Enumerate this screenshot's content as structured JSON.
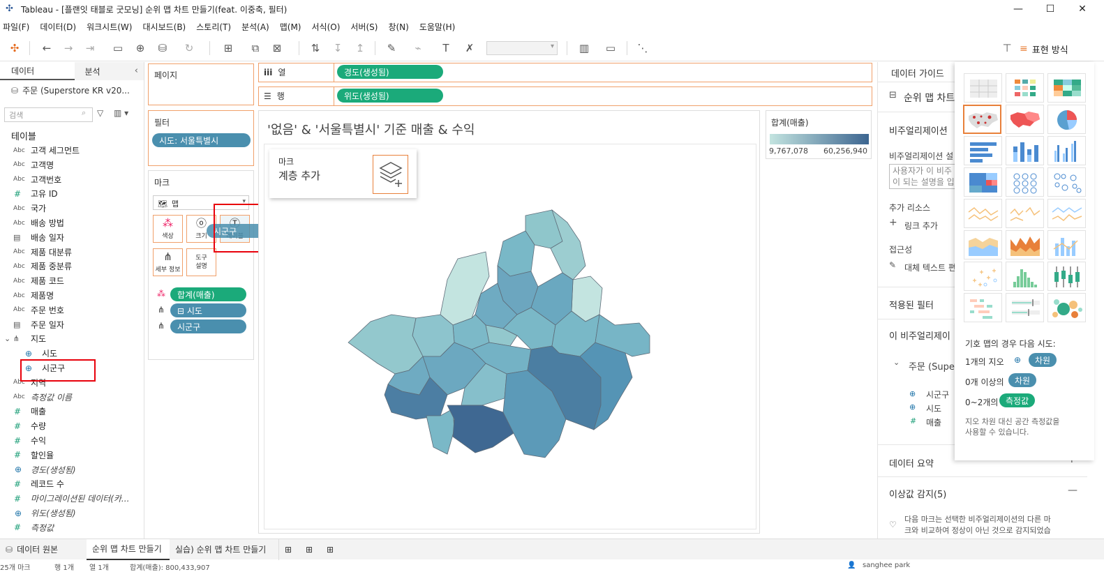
{
  "window": {
    "title": "Tableau - [플랜잇 태블로 굿모닝] 순위 맵 차트 만들기(feat. 이중축, 필터)",
    "min": "—",
    "max": "☐",
    "close": "✕"
  },
  "menu": [
    "파일(F)",
    "데이터(D)",
    "워크시트(W)",
    "대시보드(B)",
    "스토리(T)",
    "분석(A)",
    "맵(M)",
    "서식(O)",
    "서버(S)",
    "창(N)",
    "도움말(H)"
  ],
  "toolbar": {
    "show_me_label": "표현 방식"
  },
  "data_pane": {
    "tab_data": "데이터",
    "tab_analysis": "분석",
    "datasource": "주문 (Superstore KR v20...",
    "search_placeholder": "검색",
    "tables_label": "테이블",
    "fields": [
      {
        "type": "Abc",
        "name": "고객 세그먼트"
      },
      {
        "type": "Abc",
        "name": "고객명"
      },
      {
        "type": "Abc",
        "name": "고객번호"
      },
      {
        "type": "#",
        "name": "고유 ID"
      },
      {
        "type": "Abc",
        "name": "국가"
      },
      {
        "type": "Abc",
        "name": "배송 방법"
      },
      {
        "type": "cal",
        "name": "배송 일자"
      },
      {
        "type": "Abc",
        "name": "제품 대분류"
      },
      {
        "type": "Abc",
        "name": "제품 중분류"
      },
      {
        "type": "Abc",
        "name": "제품 코드"
      },
      {
        "type": "Abc",
        "name": "제품명"
      },
      {
        "type": "Abc",
        "name": "주문 번호"
      },
      {
        "type": "cal",
        "name": "주문 일자"
      },
      {
        "type": "hier",
        "name": "지도"
      },
      {
        "type": "geo",
        "name": "시도"
      },
      {
        "type": "geo",
        "name": "시군구"
      },
      {
        "type": "Abc",
        "name": "지역"
      },
      {
        "type": "Abc",
        "name": "측정값 이름"
      },
      {
        "type": "#",
        "name": "매출"
      },
      {
        "type": "#",
        "name": "수량"
      },
      {
        "type": "#",
        "name": "수익"
      },
      {
        "type": "#",
        "name": "할인율"
      },
      {
        "type": "geo",
        "name": "경도(생성됨)"
      },
      {
        "type": "#",
        "name": "레코드 수"
      },
      {
        "type": "#",
        "name": "마이그레이션된 데이터(카..."
      },
      {
        "type": "geo",
        "name": "위도(생성됨)"
      },
      {
        "type": "#",
        "name": "측정값"
      }
    ]
  },
  "shelves": {
    "pages_label": "페이지",
    "columns_label": "열",
    "rows_label": "행",
    "columns_pill": "경도(생성됨)",
    "rows_pill": "위도(생성됨)",
    "filters_label": "필터",
    "filter_pill": "시도: 서울특별시",
    "marks_label": "마크",
    "mark_type": "맵",
    "mark_buttons": {
      "color": "색상",
      "size": "크기",
      "label": "레이블",
      "detail": "세부 정보",
      "tooltip": "도구 설명"
    },
    "mark_pills": [
      "합계(매출)",
      "⊟ 시도",
      "시군구"
    ],
    "drag_pill": "시군구"
  },
  "viz": {
    "title": "'없음' & '서울특별시' 기준 매출 & 수익",
    "layer_label": "마크",
    "layer_action": "계층 추가",
    "legend_title": "합계(매출)",
    "legend_min": "9,767,078",
    "legend_max": "60,256,940",
    "colors": {
      "min": "#c3e4e0",
      "max": "#3c6590"
    }
  },
  "guide": {
    "title": "데이터 가이드",
    "chart_title": "순위 맵 차트",
    "viz_desc_head": "비주얼리제이션",
    "viz_desc_label": "비주얼리제이션 설",
    "viz_desc_placeholder_1": "사용자가 이 비주",
    "viz_desc_placeholder_2": "이 되는 설명을 입",
    "resources": "추가 리소스",
    "add_link": "링크 추가",
    "access": "접근성",
    "alt_text": "대체 텍스트 편",
    "applied_filters": "적용된 필터",
    "this_viz": "이 비주얼리제이",
    "source": "주문 (Supe",
    "used_fields": [
      "시군구",
      "시도",
      "매출"
    ],
    "data_summary": "데이터 요약",
    "outliers": "이상값 감지(5)",
    "outliers_text_1": "다음 마크는 선택한 비주얼리제이션의 다른 마",
    "outliers_text_2": "크와 비교하여 정상이 아닌 것으로 감지되었습"
  },
  "show_me": {
    "hint_title": "기호 맵의 경우 다음 시도:",
    "req1_prefix": "1개의 지오",
    "req1_pill": "차원",
    "req2_prefix": "0개 이상의",
    "req2_pill": "차원",
    "req3_prefix": "0~2개의",
    "req3_pill": "측정값",
    "note_1": "지오 차원 대신 공간 측정값을",
    "note_2": "사용할 수 있습니다."
  },
  "sheets": {
    "datasource_tab": "데이터 원본",
    "tabs": [
      "순위 맵 차트 만들기",
      "실습) 순위 맵 차트 만들기"
    ]
  },
  "status": {
    "marks": "25개 마크",
    "rows": "행 1개",
    "cols": "열 1개",
    "sum": "합계(매출): 800,433,907",
    "user": "sanghee park"
  }
}
